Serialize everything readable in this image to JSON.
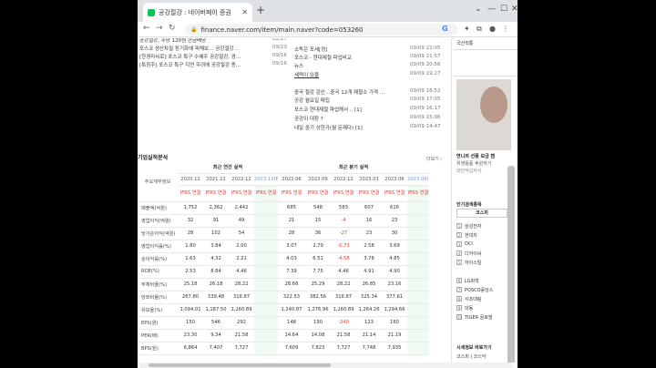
{
  "tab": {
    "title": "공강절강 : 네이버페이 증권"
  },
  "addr": {
    "url": "finance.naver.com/item/main.naver?code=053260"
  },
  "news_left": [
    {
      "title": "공강절강, 주당 120원 현금배당",
      "date": "02/27"
    },
    {
      "title": "포스코 생산차질 장기화에 피해보… 공강절강…",
      "date": "09/23"
    },
    {
      "title": "[한경라씨로] 포스코 특구 수혜주 공강절강, 경…",
      "date": "09/16"
    },
    {
      "title": "[특징주] 포스코 특구 지연 우려에 공강절강 증…",
      "date": "09/16"
    }
  ],
  "news_right": [
    {
      "title": "소독은 포세[정]",
      "date": "09/09 22:05"
    },
    {
      "title": "포스코 - 현대제철 파업비교",
      "date": "09/09 21:57"
    },
    {
      "title": "뉴스",
      "date": "09/09 20:56"
    },
    {
      "title": "세력이 있을",
      "date": "09/09 19:27"
    },
    {
      "title": "중국 철강 감산…중국 12개 제철소 가격 …",
      "date": "09/09 18:52"
    },
    {
      "title": "공강 월요일 매집",
      "date": "09/09 17:05"
    },
    {
      "title": "포스코 현대제철 파업해서 .. [1]",
      "date": "09/09 16:17"
    },
    {
      "title": "공강이 대장 ?",
      "date": "09/09 15:06"
    },
    {
      "title": "내일 중기 상한가(월 문제다) [1]",
      "date": "09/09 14:47"
    }
  ],
  "fin": {
    "title": "기업실적분석",
    "more": "더보기 ›",
    "row_label": "주요재무정보",
    "group_annual": "최근 연간 실적",
    "group_quarter": "최근 분기 실적",
    "columns": [
      "2020.12",
      "2021.12",
      "2022.12",
      "2023.12(E)",
      "2022.06",
      "2022.09",
      "2022.12",
      "2023.03",
      "2023.06",
      "2023.09(E)"
    ],
    "ifrs": "IFRS 연결",
    "rows": [
      {
        "label": "매출액(억원)",
        "values": [
          "1,752",
          "2,362",
          "2,442",
          "",
          "685",
          "548",
          "583",
          "607",
          "616",
          ""
        ]
      },
      {
        "label": "영업이익(억원)",
        "values": [
          "32",
          "91",
          "49",
          "",
          "21",
          "15",
          "-4",
          "16",
          "23",
          ""
        ]
      },
      {
        "label": "당기순이익(억원)",
        "values": [
          "28",
          "102",
          "54",
          "",
          "28",
          "36",
          "-27",
          "23",
          "30",
          ""
        ]
      },
      {
        "label": "영업이익률(%)",
        "values": [
          "1.80",
          "3.84",
          "2.00",
          "",
          "3.07",
          "2.79",
          "-0.73",
          "2.58",
          "3.69",
          ""
        ]
      },
      {
        "label": "순이익률(%)",
        "values": [
          "1.63",
          "4.32",
          "2.21",
          "",
          "4.03",
          "6.51",
          "-4.58",
          "3.78",
          "4.85",
          ""
        ]
      },
      {
        "label": "ROE(%)",
        "values": [
          "2.53",
          "8.84",
          "4.46",
          "",
          "7.39",
          "7.75",
          "4.46",
          "4.91",
          "4.90",
          ""
        ]
      },
      {
        "label": "부채비율(%)",
        "values": [
          "25.18",
          "26.18",
          "28.22",
          "",
          "28.66",
          "25.29",
          "28.22",
          "26.85",
          "23.16",
          ""
        ]
      },
      {
        "label": "당좌비율(%)",
        "values": [
          "267.80",
          "339.48",
          "316.87",
          "",
          "322.53",
          "382.56",
          "316.87",
          "325.34",
          "377.61",
          ""
        ]
      },
      {
        "label": "유보율(%)",
        "values": [
          "1,094.01",
          "1,187.50",
          "1,260.89",
          "",
          "1,240.87",
          "1,276.96",
          "1,260.89",
          "1,264.26",
          "1,294.66",
          ""
        ]
      },
      {
        "label": "EPS(원)",
        "values": [
          "150",
          "546",
          "292",
          "",
          "148",
          "190",
          "-240",
          "123",
          "160",
          ""
        ]
      },
      {
        "label": "PER(배)",
        "values": [
          "23.30",
          "9.34",
          "21.58",
          "",
          "14.64",
          "14.08",
          "21.58",
          "21.14",
          "21.19",
          ""
        ]
      },
      {
        "label": "BPS(원)",
        "values": [
          "6,864",
          "7,407",
          "7,727",
          "",
          "7,609",
          "7,823",
          "7,727",
          "7,748",
          "7,935",
          ""
        ]
      }
    ]
  },
  "side": {
    "top_label": "국산직통",
    "caption1": "연니의 선풍 모금 캠",
    "caption2": "위생용품 후원하기",
    "caption3": "대한적십자사",
    "popular_title": "인기검색종목",
    "tab_kospi": "코스피",
    "stocks": [
      "삼성전자",
      "현대차",
      "OCI",
      "디어이씨",
      "하이스틸",
      "LG화학",
      "POSCO홀딩스",
      "사조대림",
      "대동",
      "TIGER 골로벌"
    ],
    "stock_nums": [
      "1",
      "2",
      "3",
      "4",
      "5",
      "6",
      "7",
      "8",
      "9",
      "10"
    ],
    "market_title": "시세정보 바로가기",
    "market_links": "코스피 | 코스닥"
  }
}
